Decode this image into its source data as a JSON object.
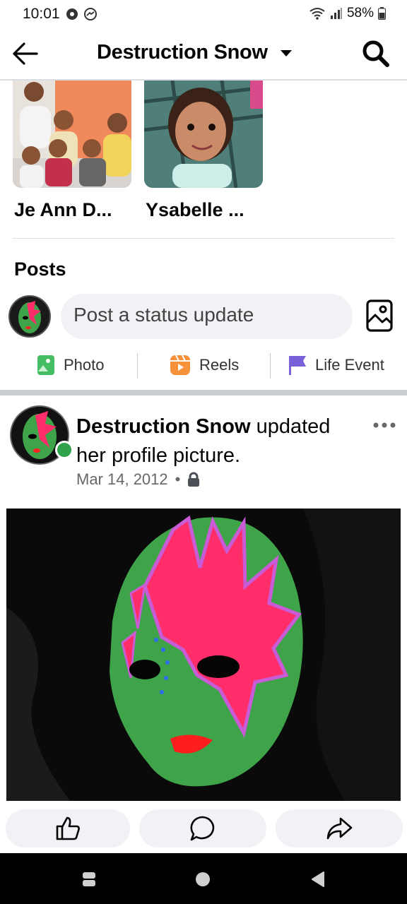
{
  "status_bar": {
    "time": "10:01",
    "battery": "58%"
  },
  "header": {
    "title": "Destruction Snow",
    "back_icon": "arrow-left-icon",
    "dropdown_icon": "caret-down-icon",
    "search_icon": "search-icon"
  },
  "friends": [
    {
      "name": "Je Ann D..."
    },
    {
      "name": "Ysabelle ..."
    }
  ],
  "posts_section": {
    "title": "Posts",
    "composer_placeholder": "Post a status update",
    "actions": [
      {
        "label": "Photo",
        "icon": "photo-icon",
        "color": "#45bd62"
      },
      {
        "label": "Reels",
        "icon": "reels-icon",
        "color": "#f7923b"
      },
      {
        "label": "Life Event",
        "icon": "flag-icon",
        "color": "#7b61d9"
      }
    ]
  },
  "post": {
    "author": "Destruction Snow",
    "action_text": " updated her profile picture.",
    "date": "Mar 14, 2012",
    "separator": "•",
    "privacy_icon": "lock-icon",
    "online": true
  },
  "reactions": [
    {
      "icon": "like-icon"
    },
    {
      "icon": "comment-icon"
    },
    {
      "icon": "share-icon"
    }
  ],
  "colors": {
    "accent_green": "#31a24c",
    "mask_green": "#3fa34a",
    "mask_pink": "#ff2e6a",
    "gray_bg": "#f0f2f5"
  }
}
